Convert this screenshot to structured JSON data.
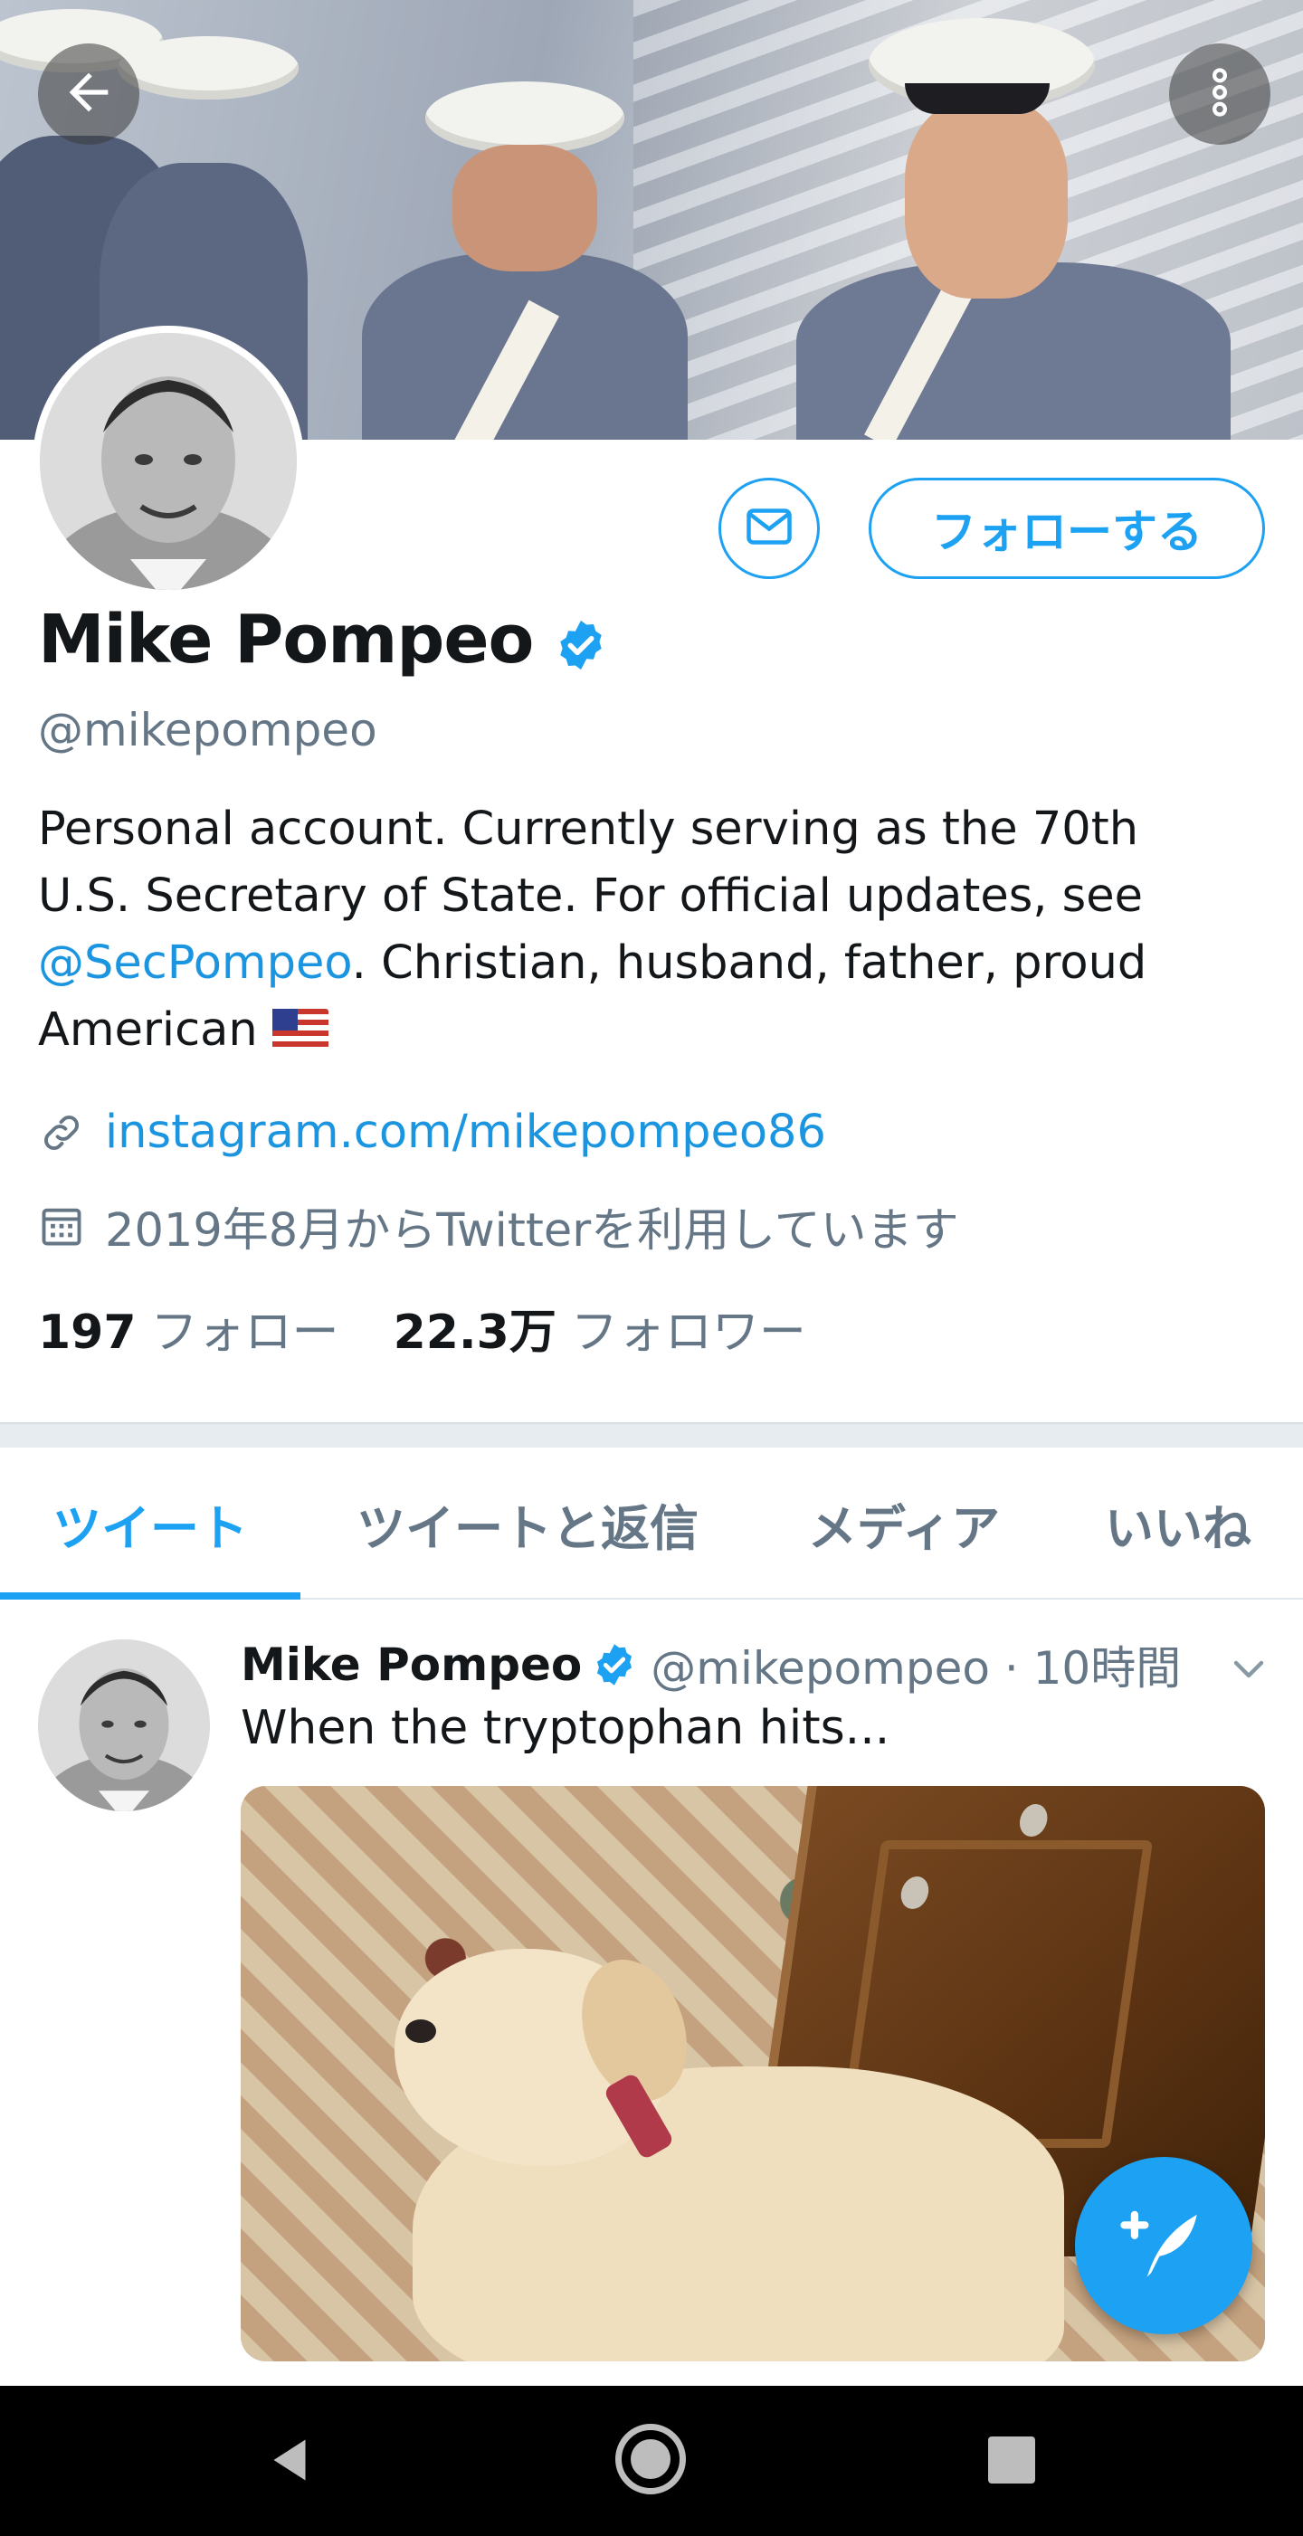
{
  "colors": {
    "accent": "#1da1f2",
    "link": "#1b95e0",
    "text": "#14171a",
    "secondary_text": "#657786",
    "divider": "#e6ecf0",
    "nav_bar": "#000000"
  },
  "header": {
    "back_icon": "arrow-left-icon",
    "more_icon": "vertical-dots-icon"
  },
  "profile": {
    "message_icon": "envelope-icon",
    "follow_label": "フォローする",
    "name": "Mike Pompeo",
    "verified_icon": "verified-badge-icon",
    "handle": "@mikepompeo",
    "bio": {
      "line1": "Personal account. Currently serving as the 70th",
      "line2": "U.S. Secretary of State. For official updates, see",
      "mention": "@SecPompeo",
      "line3_rest": ". Christian, husband, father, proud",
      "line4": "American",
      "flag_icon": "us-flag-icon"
    },
    "link_icon": "link-icon",
    "website": "instagram.com/mikepompeo86",
    "calendar_icon": "calendar-icon",
    "joined": "2019年8月からTwitterを利用しています",
    "following_count": "197",
    "following_label": "フォロー",
    "followers_count": "22.3万",
    "followers_label": "フォロワー"
  },
  "tabs": [
    {
      "label": "ツイート",
      "active": true
    },
    {
      "label": "ツイートと返信",
      "active": false
    },
    {
      "label": "メディア",
      "active": false
    },
    {
      "label": "いいね",
      "active": false
    }
  ],
  "tweet": {
    "author_name": "Mike Pompeo",
    "author_handle": "@mikepompeo · 10時間",
    "text": "When the tryptophan hits...",
    "caret_icon": "chevron-down-icon",
    "media_icon": "dog-photo"
  },
  "fab": {
    "icon": "compose-tweet-icon"
  },
  "system_nav": {
    "back_icon": "nav-back-icon",
    "home_icon": "nav-home-icon",
    "recent_icon": "nav-recent-apps-icon"
  }
}
